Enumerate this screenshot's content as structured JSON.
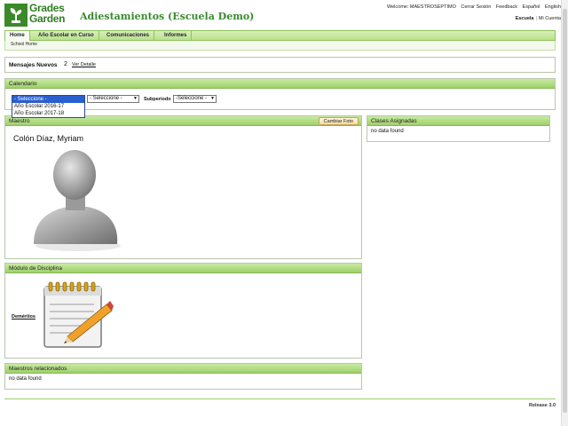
{
  "brand": {
    "logo_line1": "Grades",
    "logo_line2": "Garden",
    "school_name": "Adiestamientos (Escuela Demo)"
  },
  "top_links": {
    "welcome": "Welcome: MAESTROSEPTIMO",
    "logout": "Cerrar Sesión",
    "feedback": "Feedback",
    "spanish": "Español",
    "english": "English"
  },
  "account_links": {
    "school": "Escuela",
    "separator": "|",
    "my_account": "Mi Cuenta"
  },
  "nav": {
    "items": [
      {
        "label": "Home"
      },
      {
        "label": "Año Escolar en Curso"
      },
      {
        "label": "Comunicaciones"
      },
      {
        "label": "Informes"
      }
    ],
    "sub_label": "School Home"
  },
  "messages": {
    "label": "Mensajes Nuevos",
    "count": "2",
    "detail_link": "Ver Detalle"
  },
  "calendar": {
    "title": "Calendario",
    "year_dropdown": {
      "options": [
        "- Seleccione -",
        "Año Escolar 2016-17",
        "Año Escolar 2017-18"
      ]
    },
    "period_select": "- Seleccione -",
    "subperiod_label": "Subperiodo",
    "subperiod_select": "-Seleccione -"
  },
  "maestro": {
    "title": "Maestro",
    "change_photo": "Cambiar Foto",
    "teacher_name": "Colón Díaz, Myriam"
  },
  "clases": {
    "title": "Clases Asignadas",
    "empty": "no data found"
  },
  "disciplina": {
    "title": "Módulo de Disciplina",
    "demeritos": "Deméritos"
  },
  "relacionados": {
    "title": "Maestros relacionados",
    "empty": "no data found"
  },
  "footer": {
    "release": "Release 3.0"
  },
  "colors": {
    "brand_green": "#3a8a2a",
    "header_green": "#9fd06b",
    "button_tan": "#f4dca0"
  }
}
